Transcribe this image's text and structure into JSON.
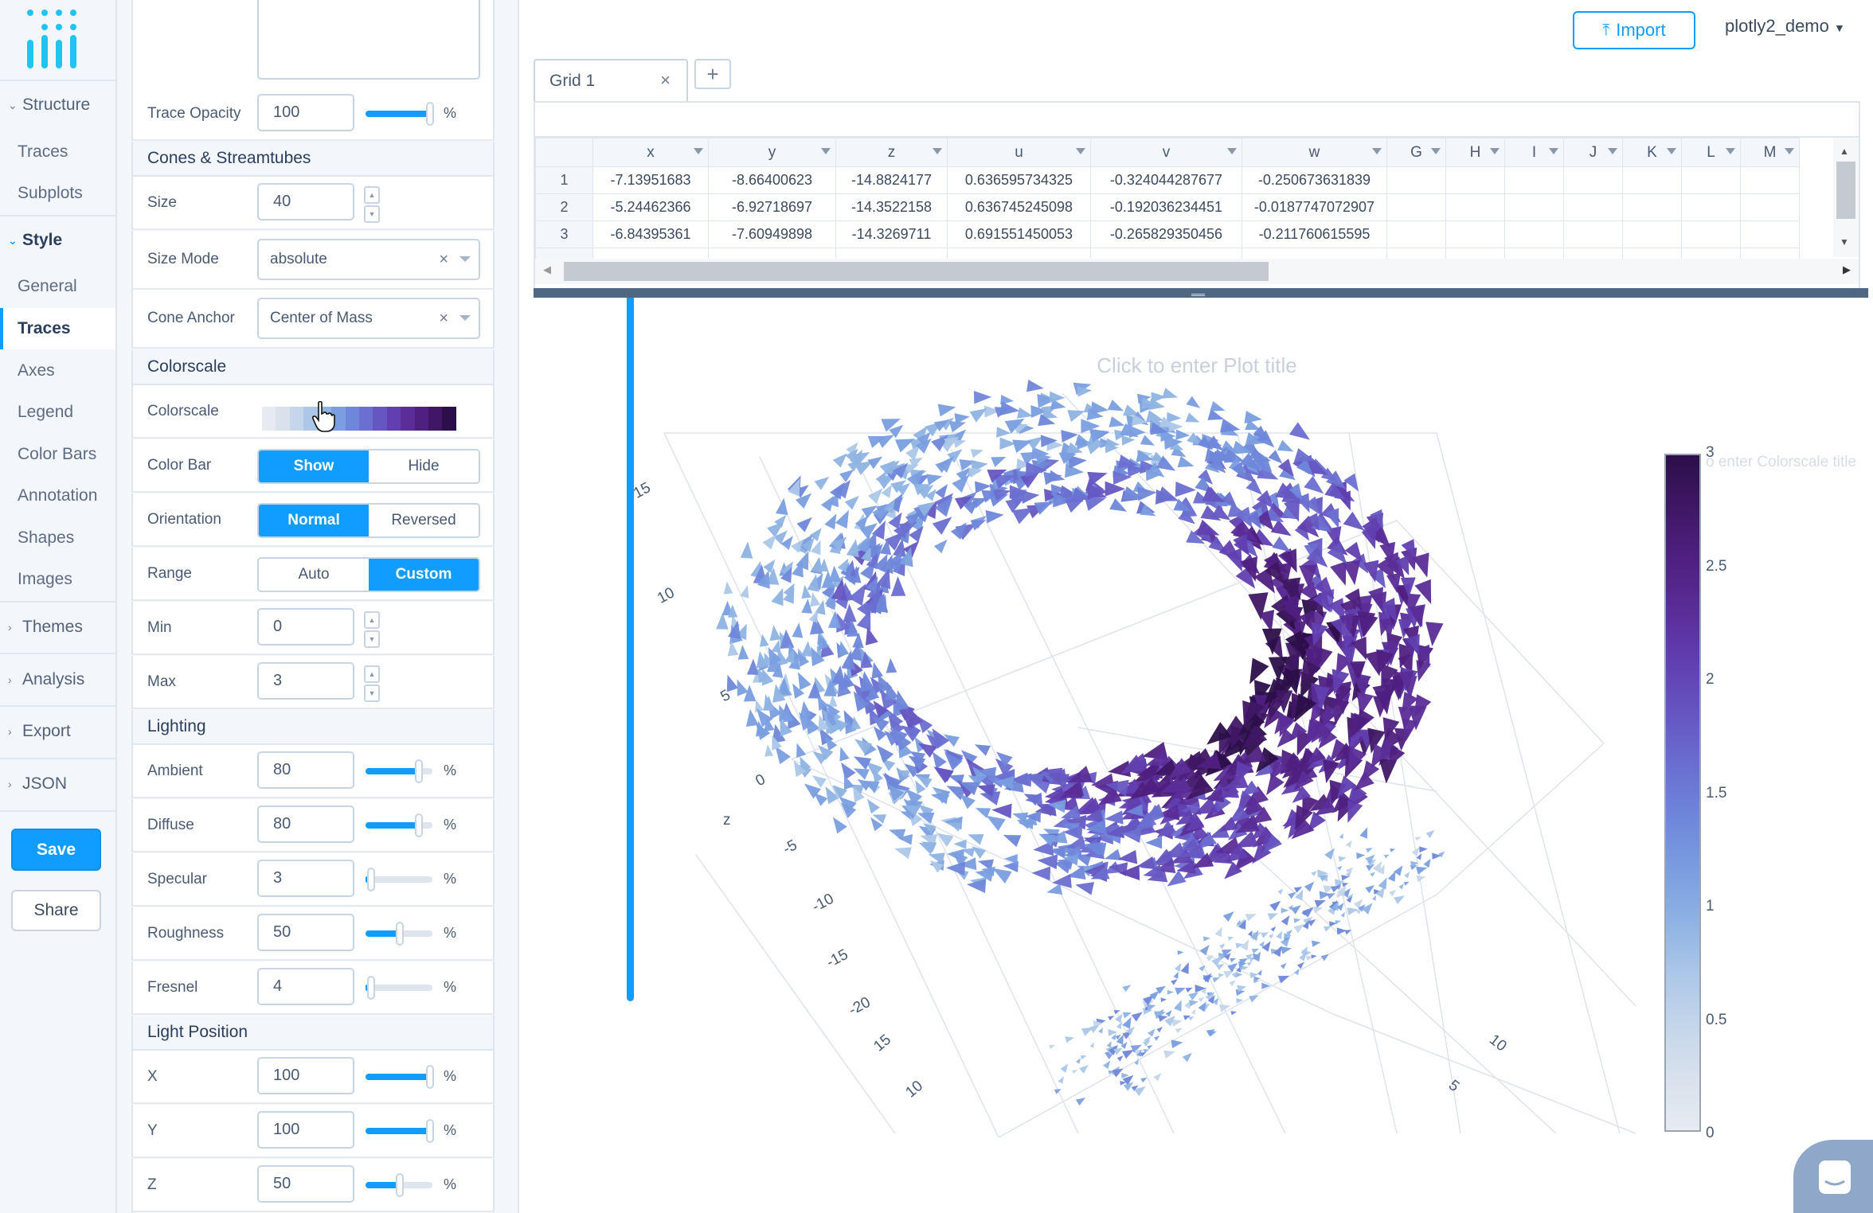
{
  "nav": {
    "structure": "Structure",
    "structure_items": [
      "Traces",
      "Subplots"
    ],
    "style": "Style",
    "style_items": [
      "General",
      "Traces",
      "Axes",
      "Legend",
      "Color Bars",
      "Annotation",
      "Shapes",
      "Images"
    ],
    "active_item": "Traces",
    "themes": "Themes",
    "analysis": "Analysis",
    "export": "Export",
    "json": "JSON",
    "save": "Save",
    "share": "Share"
  },
  "panel": {
    "trace_opacity_label": "Trace Opacity",
    "trace_opacity_value": "100",
    "trace_opacity_fraction": 1.0,
    "cones_header": "Cones & Streamtubes",
    "size_label": "Size",
    "size_value": "40",
    "size_mode_label": "Size Mode",
    "size_mode_value": "absolute",
    "cone_anchor_label": "Cone Anchor",
    "cone_anchor_value": "Center of Mass",
    "colorscale_header": "Colorscale",
    "colorscale_label": "Colorscale",
    "colorscale_colors": [
      "#e7eaf1",
      "#d9e1ed",
      "#c5d6ea",
      "#acc7e8",
      "#8fb3e3",
      "#7a9ee0",
      "#6f87da",
      "#6a6fd0",
      "#6656c2",
      "#613fb0",
      "#5a2d98",
      "#4f2080",
      "#3f1764",
      "#2c0f4a"
    ],
    "color_bar_label": "Color Bar",
    "color_bar_options": [
      "Show",
      "Hide"
    ],
    "color_bar_selected": "Show",
    "orientation_label": "Orientation",
    "orientation_options": [
      "Normal",
      "Reversed"
    ],
    "orientation_selected": "Normal",
    "range_label": "Range",
    "range_options": [
      "Auto",
      "Custom"
    ],
    "range_selected": "Custom",
    "min_label": "Min",
    "min_value": "0",
    "max_label": "Max",
    "max_value": "3",
    "lighting_header": "Lighting",
    "ambient_label": "Ambient",
    "ambient_value": "80",
    "diffuse_label": "Diffuse",
    "diffuse_value": "80",
    "specular_label": "Specular",
    "specular_value": "3",
    "roughness_label": "Roughness",
    "roughness_value": "50",
    "fresnel_label": "Fresnel",
    "fresnel_value": "4",
    "light_position_header": "Light Position",
    "x_label": "X",
    "x_value": "100",
    "y_label": "Y",
    "y_value": "100",
    "z_label": "Z",
    "z_value": "50",
    "percent": "%"
  },
  "topbar": {
    "import_label": "Import",
    "user_label": "plotly2_demo"
  },
  "grid": {
    "tab_label": "Grid 1",
    "add_label": "+",
    "columns": [
      "x",
      "y",
      "z",
      "u",
      "v",
      "w",
      "G",
      "H",
      "I",
      "J",
      "K",
      "L",
      "M"
    ],
    "rows": [
      [
        "1",
        "-7.13951683",
        "-8.66400623",
        "-14.8824177",
        "0.636595734325",
        "-0.324044287677",
        "-0.250673631839"
      ],
      [
        "2",
        "-5.24462366",
        "-6.92718697",
        "-14.3522158",
        "0.636745245098",
        "-0.192036234451",
        "-0.0187747072907"
      ],
      [
        "3",
        "-6.84395361",
        "-7.60949898",
        "-14.3269711",
        "0.691551450053",
        "-0.265829350456",
        "-0.211760615595"
      ]
    ]
  },
  "plot": {
    "title_placeholder": "Click to enter Plot title",
    "colorbar_title_placeholder": "o enter Colorscale title",
    "colorbar_ticks": [
      "3",
      "2.5",
      "2",
      "1.5",
      "1",
      "0.5",
      "0"
    ],
    "z_axis_label": "z",
    "z_ticks": [
      "15",
      "10",
      "5",
      "0",
      "-5",
      "-10",
      "-15",
      "-20"
    ],
    "x_ticks": [
      "15",
      "10"
    ],
    "y_ticks": [
      "10",
      "5"
    ]
  }
}
